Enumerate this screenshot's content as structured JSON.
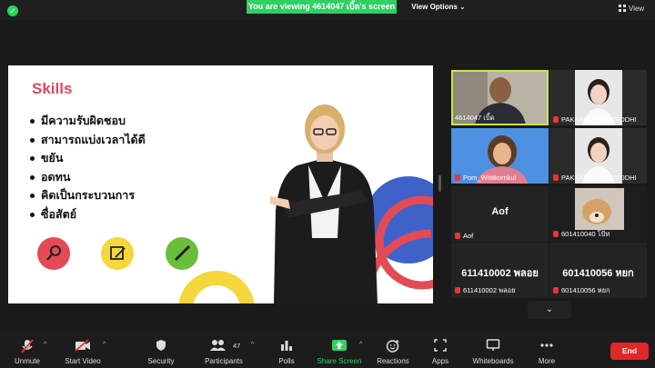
{
  "banner": {
    "text": "You are viewing 4614047 เบิ้ด's screen"
  },
  "view_options": {
    "label": "View Options",
    "caret": "⌄"
  },
  "view_button": {
    "label": "View"
  },
  "slide": {
    "title": "Skills",
    "bullets": [
      "มีความรับผิดชอบ",
      "สามารถแบ่งเวลาได้ดี",
      "ขยัน",
      "อดทน",
      "คิดเป็นกระบวนการ",
      "ซื่อสัตย์"
    ],
    "icons": [
      "magnifier-icon",
      "note-icon",
      "pencil-icon"
    ]
  },
  "gallery": {
    "tiles": [
      {
        "name": "4614047 เบิ้ด",
        "active": true,
        "muted": false
      },
      {
        "name": "PAKKANUT BANSIDDHI",
        "active": false,
        "muted": true
      },
      {
        "name": "Pom_Wititkornkul",
        "active": false,
        "muted": true
      },
      {
        "name": "PAKKANUT BANSIDDHI",
        "active": false,
        "muted": true
      },
      {
        "name": "Aof",
        "big": "Aof",
        "active": false,
        "muted": true
      },
      {
        "name": "601410040 โป้ท",
        "active": false,
        "muted": true
      },
      {
        "name": "611410002 พลอย",
        "big": "611410002 พลอย",
        "active": false,
        "muted": true
      },
      {
        "name": "601410056 หยก",
        "big": "601410056 หยก",
        "active": false,
        "muted": true
      }
    ],
    "scroll_chevron": "⌄"
  },
  "toolbar": {
    "unmute": "Unmute",
    "start_video": "Start Video",
    "security": "Security",
    "participants": "Participants",
    "participants_count": "47",
    "polls": "Polls",
    "share_screen": "Share Screen",
    "reactions": "Reactions",
    "apps": "Apps",
    "whiteboards": "Whiteboards",
    "more": "More",
    "end": "End",
    "caret": "^"
  },
  "colors": {
    "share_green": "#2fd064",
    "end_red": "#e02828",
    "active_speaker": "#c8e64a",
    "slide_title": "#e0475a"
  }
}
